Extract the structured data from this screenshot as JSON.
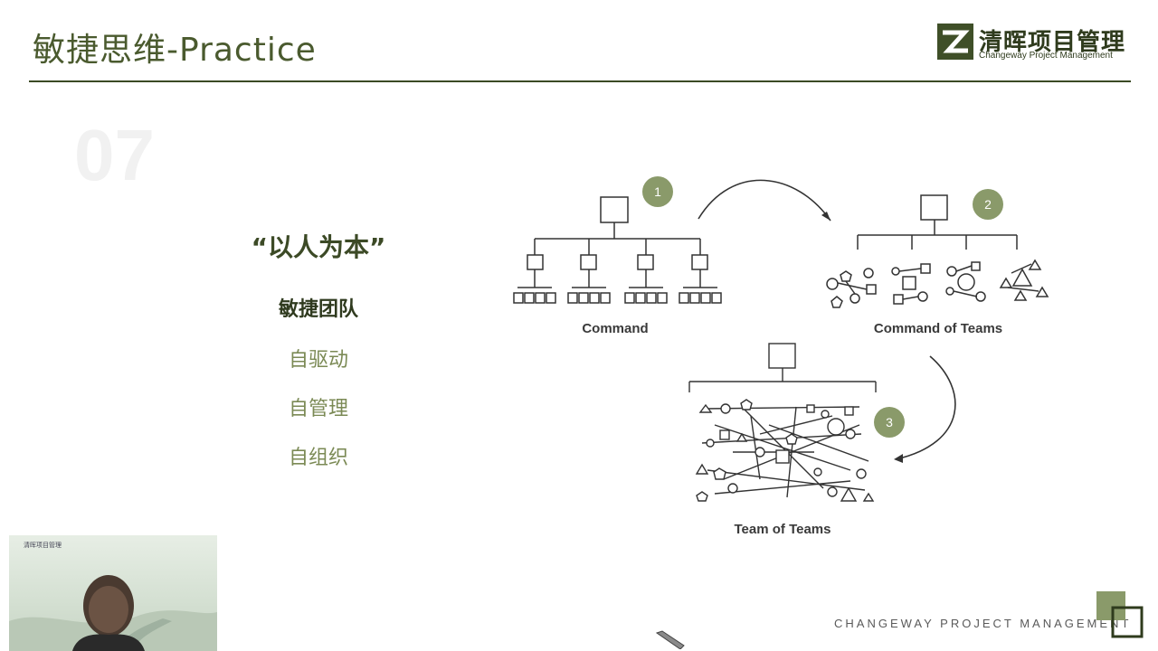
{
  "header": {
    "title": "敏捷思维-Practice",
    "logo_cn": "清晖项目管理",
    "logo_en": "Changeway Project Management"
  },
  "section_number": "07",
  "left": {
    "quote": "“以人为本”",
    "subtitle": "敏捷团队",
    "items": [
      "自驱动",
      "自管理",
      "自组织"
    ]
  },
  "diagram": {
    "labels": [
      "Command",
      "Command of Teams",
      "Team of Teams"
    ],
    "steps": [
      "1",
      "2",
      "3"
    ]
  },
  "webcam": {
    "logo_text": "清晖项目管理"
  },
  "footer": {
    "text": "CHANGEWAY PROJECT MANAGEMENT"
  },
  "colors": {
    "accent": "#8a9a6a",
    "title": "#4a5a2e",
    "rule": "#3b4a24"
  }
}
